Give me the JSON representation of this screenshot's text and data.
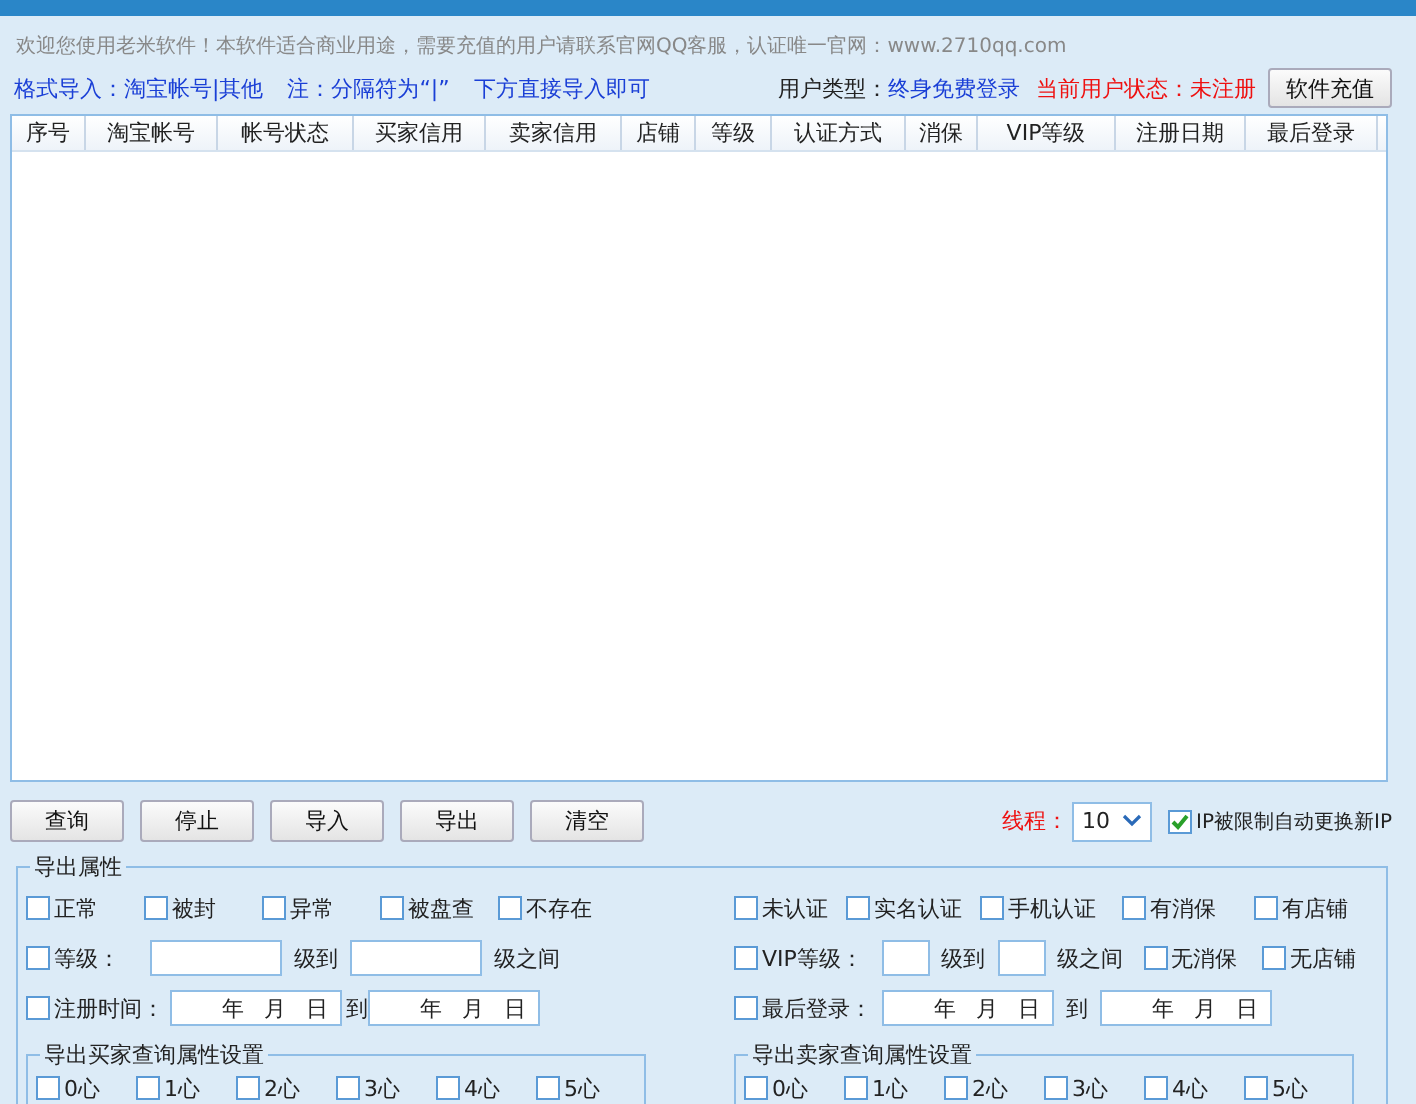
{
  "notice": "欢迎您使用老米软件！本软件适合商业用途，需要充值的用户请联系官网QQ客服，认证唯一官网：www.2710qq.com",
  "format_hints": [
    "格式导入：淘宝帐号|其他",
    "注：分隔符为“|”",
    "下方直接导入即可"
  ],
  "user_type": {
    "label": "用户类型：",
    "value": "终身免费登录"
  },
  "user_status": "当前用户状态：未注册",
  "recharge_button": "软件充值",
  "table": {
    "columns": [
      "序号",
      "淘宝帐号",
      "帐号状态",
      "买家信用",
      "卖家信用",
      "店铺",
      "等级",
      "认证方式",
      "消保",
      "VIP等级",
      "注册日期",
      "最后登录"
    ]
  },
  "buttons": [
    "查询",
    "停止",
    "导入",
    "导出",
    "清空"
  ],
  "threads": {
    "label": "线程：",
    "value": "10"
  },
  "ip_option": {
    "label": "IP被限制自动更换新IP",
    "checked": true
  },
  "export": {
    "title": "导出属性",
    "left_status": [
      {
        "label": "正常",
        "checked": false
      },
      {
        "label": "被封",
        "checked": false
      },
      {
        "label": "异常",
        "checked": false
      },
      {
        "label": "被盘查",
        "checked": false
      },
      {
        "label": "不存在",
        "checked": false
      }
    ],
    "level_range": {
      "label": "等级：",
      "checked": false,
      "to": "级到",
      "between": "级之间"
    },
    "reg_time": {
      "label": "注册时间：",
      "checked": false,
      "from_parts": [
        "年",
        "月",
        "日"
      ],
      "to": "到",
      "to_parts": [
        "年",
        "月",
        "日"
      ]
    },
    "right_status": [
      {
        "label": "未认证",
        "checked": false
      },
      {
        "label": "实名认证",
        "checked": false
      },
      {
        "label": "手机认证",
        "checked": false
      },
      {
        "label": "有消保",
        "checked": false
      },
      {
        "label": "有店铺",
        "checked": false
      }
    ],
    "vip_range": {
      "label": "VIP等级：",
      "checked": false,
      "to": "级到",
      "between": "级之间"
    },
    "vip_extra": [
      {
        "label": "无消保",
        "checked": false
      },
      {
        "label": "无店铺",
        "checked": false
      }
    ],
    "last_login": {
      "label": "最后登录：",
      "checked": false,
      "from_parts": [
        "年",
        "月",
        "日"
      ],
      "to": "到",
      "to_parts": [
        "年",
        "月",
        "日"
      ]
    },
    "buyer_group": {
      "title": "导出买家查询属性设置",
      "options": [
        {
          "label": "0心",
          "checked": false
        },
        {
          "label": "1心",
          "checked": false
        },
        {
          "label": "2心",
          "checked": false
        },
        {
          "label": "3心",
          "checked": false
        },
        {
          "label": "4心",
          "checked": false
        },
        {
          "label": "5心",
          "checked": false
        }
      ]
    },
    "seller_group": {
      "title": "导出卖家查询属性设置",
      "options": [
        {
          "label": "0心",
          "checked": false
        },
        {
          "label": "1心",
          "checked": false
        },
        {
          "label": "2心",
          "checked": false
        },
        {
          "label": "3心",
          "checked": false
        },
        {
          "label": "4心",
          "checked": false
        },
        {
          "label": "5心",
          "checked": false
        }
      ]
    }
  }
}
